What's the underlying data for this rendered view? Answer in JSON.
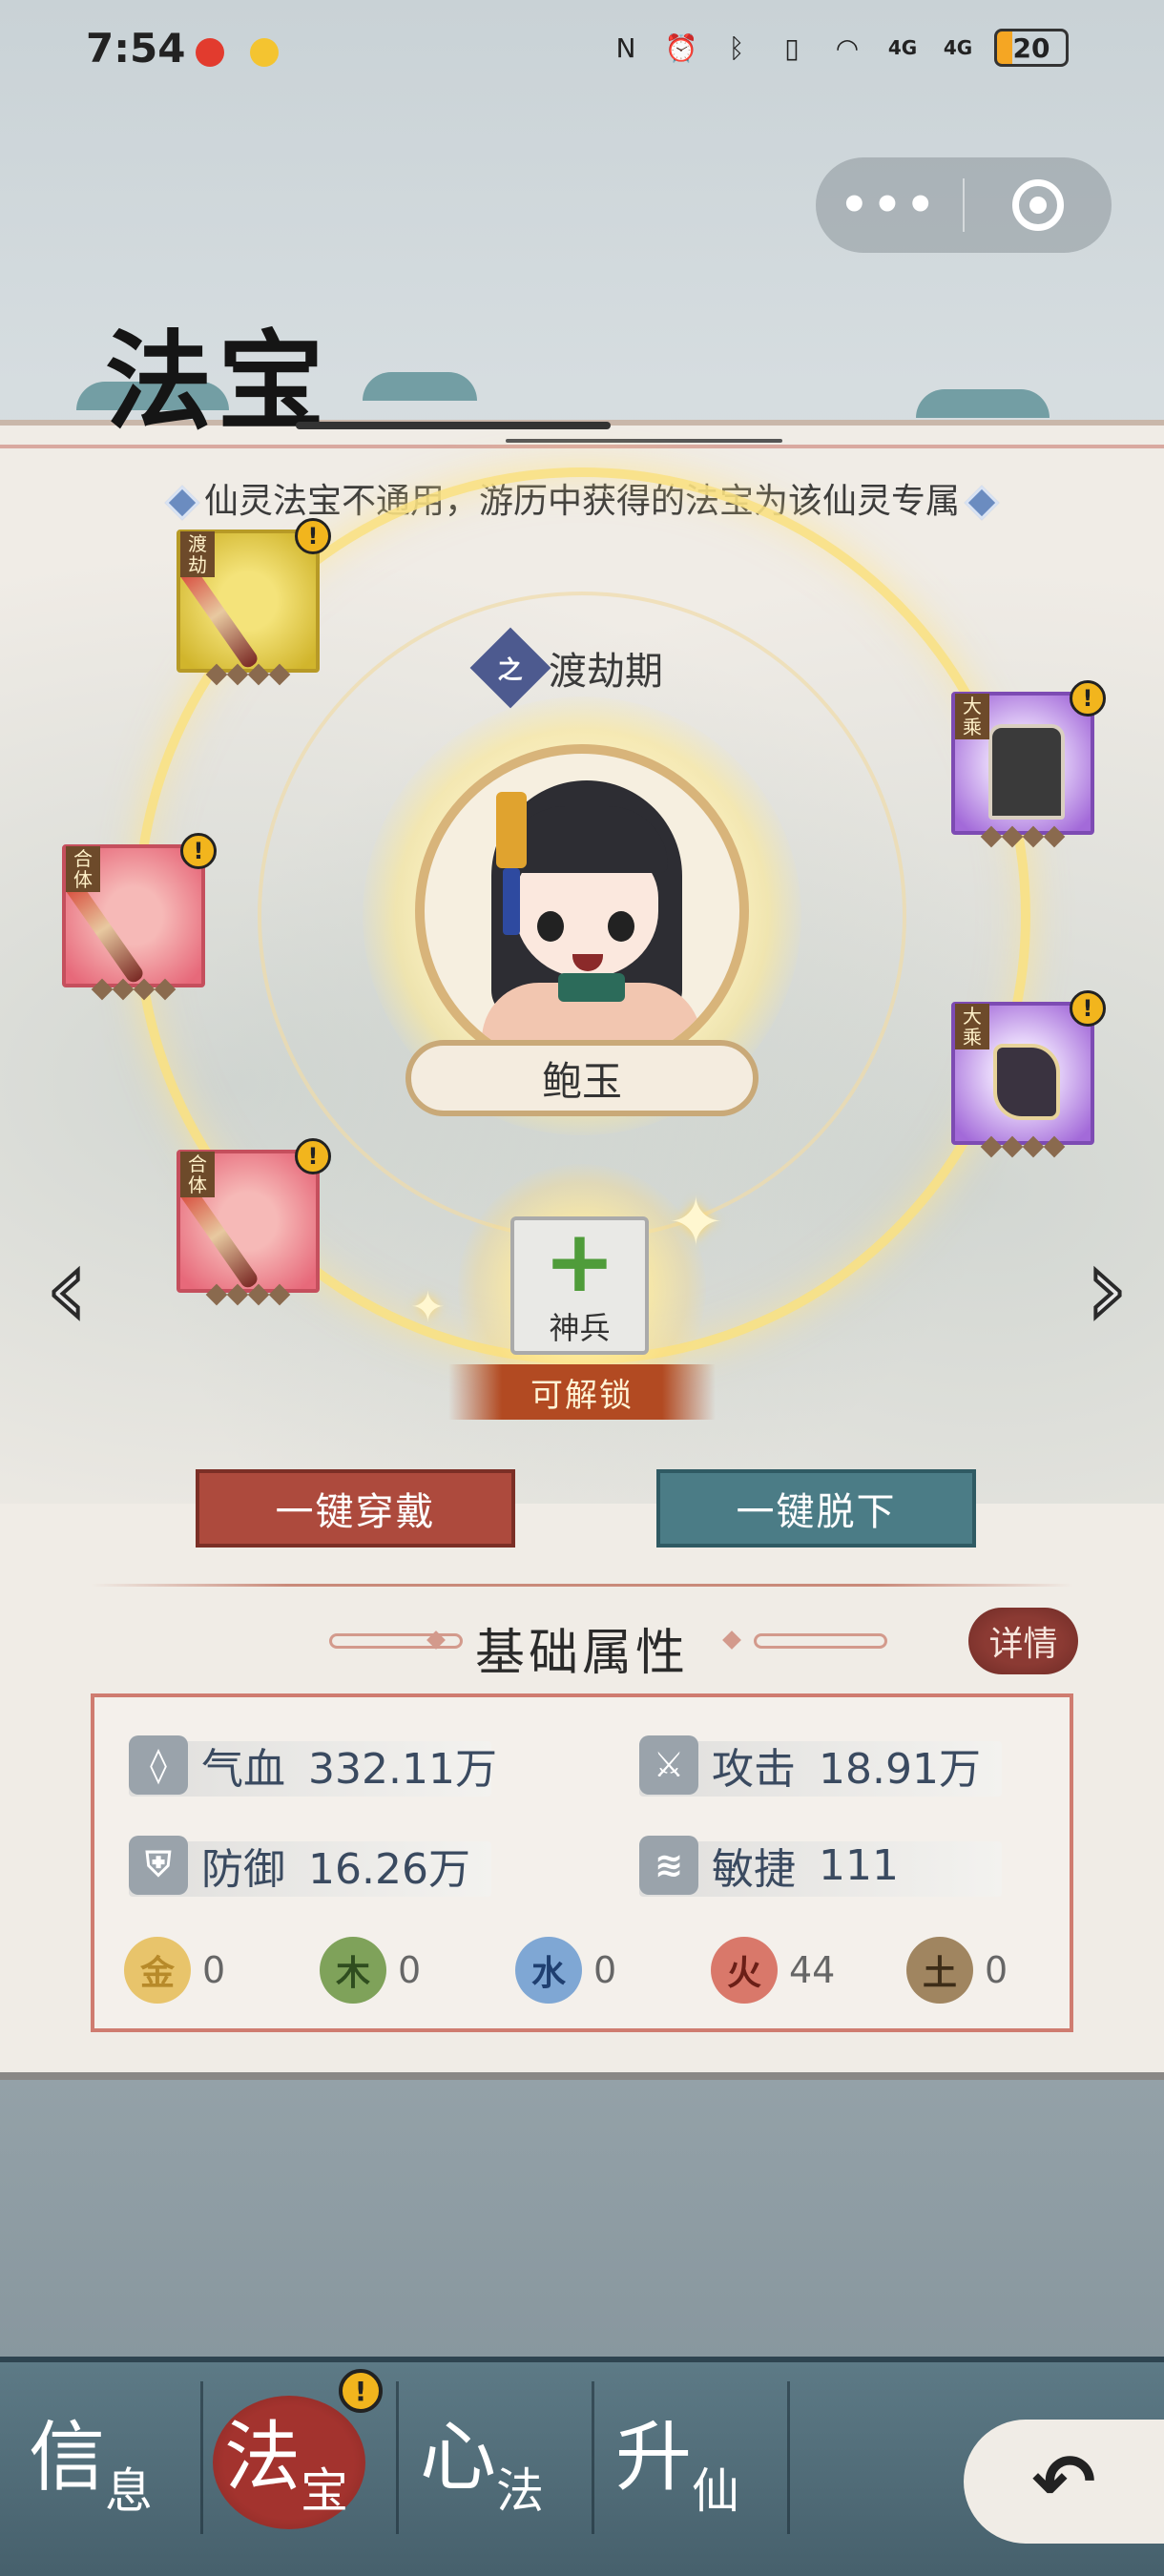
{
  "status_bar": {
    "time": "7:54",
    "signal1": "4G",
    "signal2": "4G",
    "battery": "20",
    "icons": [
      "nfc-icon",
      "alarm-icon",
      "bluetooth-icon",
      "vibrate-icon",
      "wifi-icon"
    ]
  },
  "capsule": {
    "more_icon": "more-dots-icon",
    "close_icon": "target-close-icon"
  },
  "header": {
    "title": "法宝"
  },
  "notice": "仙灵法宝不通用，游历中获得的法宝为该仙灵专属",
  "character": {
    "realm_icon_char": "之",
    "realm": "渡劫期",
    "name": "鲍玉"
  },
  "equipment": [
    {
      "tag": "渡劫",
      "type": "weapon",
      "alert": "!"
    },
    {
      "tag": "合体",
      "type": "weapon",
      "alert": "!"
    },
    {
      "tag": "合体",
      "type": "weapon",
      "alert": "!"
    },
    {
      "tag": "大乘",
      "type": "armor",
      "alert": "!"
    },
    {
      "tag": "大乘",
      "type": "boot",
      "alert": "!"
    }
  ],
  "unlock_slot": {
    "plus": "+",
    "label": "神兵",
    "status": "可解锁"
  },
  "nav_arrows": {
    "prev": "‹",
    "next": "›"
  },
  "actions": {
    "equip_all": "一键穿戴",
    "unequip_all": "一键脱下"
  },
  "stats": {
    "title": "基础属性",
    "detail": "详情",
    "items": [
      {
        "icon_char": "◊",
        "label": "气血",
        "value": "332.11万"
      },
      {
        "icon_char": "⚔",
        "label": "攻击",
        "value": "18.91万"
      },
      {
        "icon_char": "⛨",
        "label": "防御",
        "value": "16.26万"
      },
      {
        "icon_char": "≋",
        "label": "敏捷",
        "value": "111"
      }
    ],
    "elements": [
      {
        "char": "金",
        "value": "0",
        "color": "#e8c46b"
      },
      {
        "char": "木",
        "value": "0",
        "color": "#7fa25a"
      },
      {
        "char": "水",
        "value": "0",
        "color": "#7fa7d4"
      },
      {
        "char": "火",
        "value": "44",
        "color": "#d9786a"
      },
      {
        "char": "土",
        "value": "0",
        "color": "#a08560"
      }
    ]
  },
  "bottom_nav": {
    "tabs": [
      {
        "big": "信",
        "small": "息"
      },
      {
        "big": "法",
        "small": "宝",
        "badge": "!"
      },
      {
        "big": "心",
        "small": "法"
      },
      {
        "big": "升",
        "small": "仙"
      }
    ],
    "back": "↶"
  },
  "colors": {
    "accent_red": "#ad4a3d",
    "accent_teal": "#4b7c86",
    "gold_glow": "#fae182"
  }
}
